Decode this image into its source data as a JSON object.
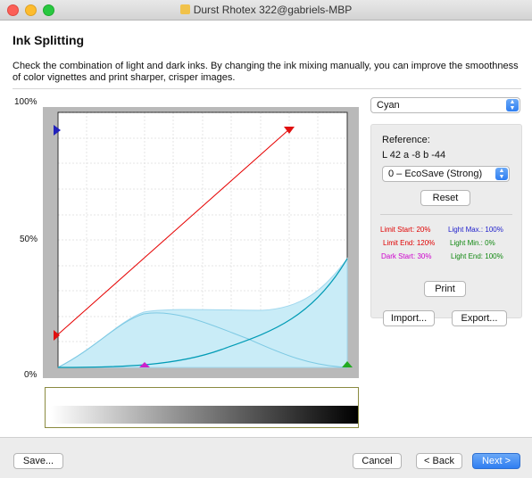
{
  "window": {
    "title": "Durst Rhotex 322@gabriels-MBP"
  },
  "page": {
    "heading": "Ink Splitting",
    "description": "Check the combination of light and dark inks. By changing the ink mixing manually, you can improve the smoothness of color vignettes and print sharper, crisper images."
  },
  "chart": {
    "y_top": "100%",
    "y_mid": "50%",
    "y_bottom": "0%",
    "colors": {
      "total": "#c9ecf7",
      "total_edge": "#9fd7ee",
      "dark": "#009bb5",
      "light": "#7dc9e3",
      "limit": "#e60000",
      "marker_red": "#e01010",
      "marker_blue": "#2222bb",
      "marker_magenta": "#cc22cc",
      "marker_green": "#22aa22"
    }
  },
  "controls": {
    "ink_select": "Cyan",
    "reference_label": "Reference:",
    "lab_value": "L 42 a -8 b -44",
    "profile_select": "0 – EcoSave (Strong)",
    "reset_button": "Reset",
    "print_button": "Print",
    "import_button": "Import...",
    "export_button": "Export..."
  },
  "stats": {
    "limit_start_label": "Limit Start:",
    "limit_start_value": "20%",
    "limit_end_label": "Limit End:",
    "limit_end_value": "120%",
    "dark_start_label": "Dark Start:",
    "dark_start_value": "30%",
    "light_max_label": "Light Max.:",
    "light_max_value": "100%",
    "light_min_label": "Light Min.:",
    "light_min_value": "0%",
    "light_end_label": "Light End:",
    "light_end_value": "100%",
    "colors": {
      "limit": "#e00000",
      "dark": "#cc00cc",
      "light_max": "#2222cc",
      "light": "#118811"
    }
  },
  "footer": {
    "save_button": "Save...",
    "cancel_button": "Cancel",
    "back_button": "< Back",
    "next_button": "Next >"
  }
}
